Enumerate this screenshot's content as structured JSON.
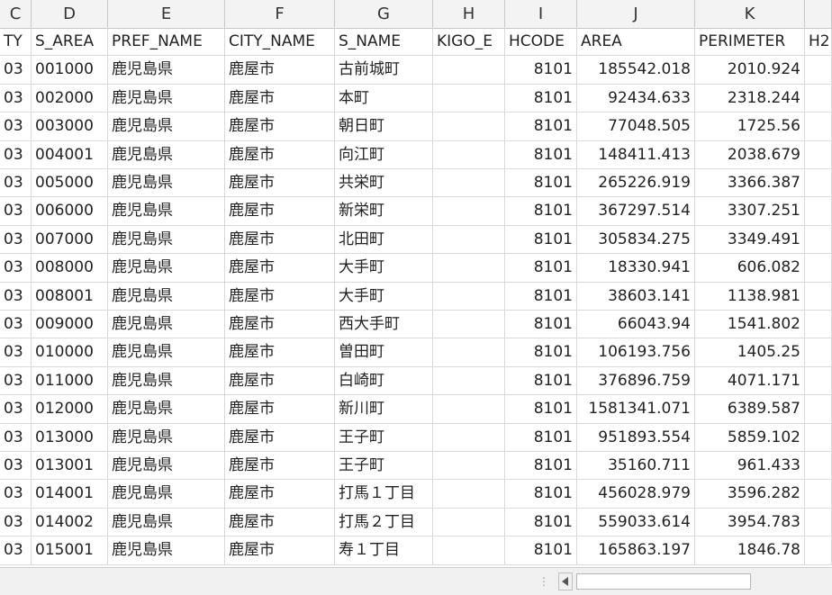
{
  "column_letters": [
    "C",
    "D",
    "E",
    "F",
    "G",
    "H",
    "I",
    "J",
    "K"
  ],
  "headers": [
    "TY",
    "S_AREA",
    "PREF_NAME",
    "CITY_NAME",
    "S_NAME",
    "KIGO_E",
    "HCODE",
    "AREA",
    "PERIMETER",
    "H2"
  ],
  "rows": [
    [
      "03",
      "001000",
      "鹿児島県",
      "鹿屋市",
      "古前城町",
      "",
      "8101",
      "185542.018",
      "2010.924"
    ],
    [
      "03",
      "002000",
      "鹿児島県",
      "鹿屋市",
      "本町",
      "",
      "8101",
      "92434.633",
      "2318.244"
    ],
    [
      "03",
      "003000",
      "鹿児島県",
      "鹿屋市",
      "朝日町",
      "",
      "8101",
      "77048.505",
      "1725.56"
    ],
    [
      "03",
      "004001",
      "鹿児島県",
      "鹿屋市",
      "向江町",
      "",
      "8101",
      "148411.413",
      "2038.679"
    ],
    [
      "03",
      "005000",
      "鹿児島県",
      "鹿屋市",
      "共栄町",
      "",
      "8101",
      "265226.919",
      "3366.387"
    ],
    [
      "03",
      "006000",
      "鹿児島県",
      "鹿屋市",
      "新栄町",
      "",
      "8101",
      "367297.514",
      "3307.251"
    ],
    [
      "03",
      "007000",
      "鹿児島県",
      "鹿屋市",
      "北田町",
      "",
      "8101",
      "305834.275",
      "3349.491"
    ],
    [
      "03",
      "008000",
      "鹿児島県",
      "鹿屋市",
      "大手町",
      "",
      "8101",
      "18330.941",
      "606.082"
    ],
    [
      "03",
      "008001",
      "鹿児島県",
      "鹿屋市",
      "大手町",
      "",
      "8101",
      "38603.141",
      "1138.981"
    ],
    [
      "03",
      "009000",
      "鹿児島県",
      "鹿屋市",
      "西大手町",
      "",
      "8101",
      "66043.94",
      "1541.802"
    ],
    [
      "03",
      "010000",
      "鹿児島県",
      "鹿屋市",
      "曽田町",
      "",
      "8101",
      "106193.756",
      "1405.25"
    ],
    [
      "03",
      "011000",
      "鹿児島県",
      "鹿屋市",
      "白崎町",
      "",
      "8101",
      "376896.759",
      "4071.171"
    ],
    [
      "03",
      "012000",
      "鹿児島県",
      "鹿屋市",
      "新川町",
      "",
      "8101",
      "1581341.071",
      "6389.587"
    ],
    [
      "03",
      "013000",
      "鹿児島県",
      "鹿屋市",
      "王子町",
      "",
      "8101",
      "951893.554",
      "5859.102"
    ],
    [
      "03",
      "013001",
      "鹿児島県",
      "鹿屋市",
      "王子町",
      "",
      "8101",
      "35160.711",
      "961.433"
    ],
    [
      "03",
      "014001",
      "鹿児島県",
      "鹿屋市",
      "打馬１丁目",
      "",
      "8101",
      "456028.979",
      "3596.282"
    ],
    [
      "03",
      "014002",
      "鹿児島県",
      "鹿屋市",
      "打馬２丁目",
      "",
      "8101",
      "559033.614",
      "3954.783"
    ],
    [
      "03",
      "015001",
      "鹿児島県",
      "鹿屋市",
      "寿１丁目",
      "",
      "8101",
      "165863.197",
      "1846.78"
    ]
  ],
  "icons": {
    "scroll_left": "triangle-left-icon",
    "splitter": "vertical-ellipsis-icon"
  }
}
